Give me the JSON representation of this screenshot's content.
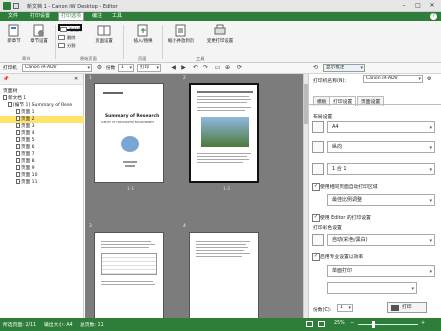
{
  "window": {
    "title": "新文档 1 - Canon iW Desktop - Editor",
    "min": "–",
    "max": "□",
    "close": "✕"
  },
  "menu": [
    "文件",
    "打印设置",
    "打印选项",
    "编注",
    "工具"
  ],
  "ribbon": {
    "buttons": {
      "new_chapter": "新章节",
      "page_settings": "章节设置",
      "delete": "删除",
      "paste": "粘贴页",
      "copy_page": "分割",
      "page_layout": "页面设置",
      "insert_replace": "插入/替换",
      "reduce_page": "缩小并放到页",
      "change_print_settings": "变更打印设置"
    },
    "groups": [
      "章节",
      "原始页面",
      "页面",
      "工具"
    ]
  },
  "toolbar": {
    "printer_label": "打印机",
    "printer_value": "Canon iR-ADV",
    "copies_label": "份数",
    "copies_value": "1",
    "print_button": "打印",
    "show_settings_button": "显示批注"
  },
  "sidebar": {
    "title": "页面树",
    "items": [
      {
        "label": "新文档 1",
        "level": 0
      },
      {
        "label": "[编节 1] Summary of Rese",
        "level": 1
      },
      {
        "label": "页面 1",
        "level": 2
      },
      {
        "label": "页面 2",
        "level": 2,
        "selected": true
      },
      {
        "label": "页面 3",
        "level": 2
      },
      {
        "label": "页面 4",
        "level": 2
      },
      {
        "label": "页面 5",
        "level": 2
      },
      {
        "label": "页面 6",
        "level": 2
      },
      {
        "label": "页面 7",
        "level": 2
      },
      {
        "label": "页面 8",
        "level": 2
      },
      {
        "label": "页面 9",
        "level": 2
      },
      {
        "label": "页面 10",
        "level": 2
      },
      {
        "label": "页面 11",
        "level": 2
      }
    ]
  },
  "pages": [
    {
      "num": "1",
      "caption": "1-1",
      "doc_title": "Summary of Research",
      "doc_sub": "SURVEY OF FRESHWATER ENVIRONMENT"
    },
    {
      "num": "2",
      "caption": "1-2"
    },
    {
      "num": "3",
      "caption": ""
    },
    {
      "num": "4",
      "caption": ""
    }
  ],
  "right_panel": {
    "printer_label": "打印机名称(N):",
    "printer_value": "Canon iR-ADV",
    "tabs": [
      "模板",
      "打印设置",
      "页面设置"
    ],
    "basic_label": "布局设置",
    "paper_size": "A4",
    "orientation": "纵向",
    "pages_per_sheet": "1 合 1",
    "use_custom_print_area": "使用相同页面自动打印区域",
    "area_value": "最佳比例调整",
    "apply_editor_settings": "使用 Editor 的打印设置",
    "color_mode_label": "打印彩色设置",
    "color_mode": "自动(彩色/黑白)",
    "use_preset": "启用专业设置以效率",
    "duplex": "单面打印",
    "copies_label": "份数(C):",
    "copies_value": "1",
    "print_button": "打印"
  },
  "status": {
    "selected_page": "所选页面: 2/11",
    "paper_size": "输出大小: A4",
    "total_pages": "总页数: 11",
    "zoom": "25%"
  },
  "colors": {
    "accent": "#2e7d3a",
    "selection": "#ffe36b",
    "canvas": "#7c7c7c"
  }
}
